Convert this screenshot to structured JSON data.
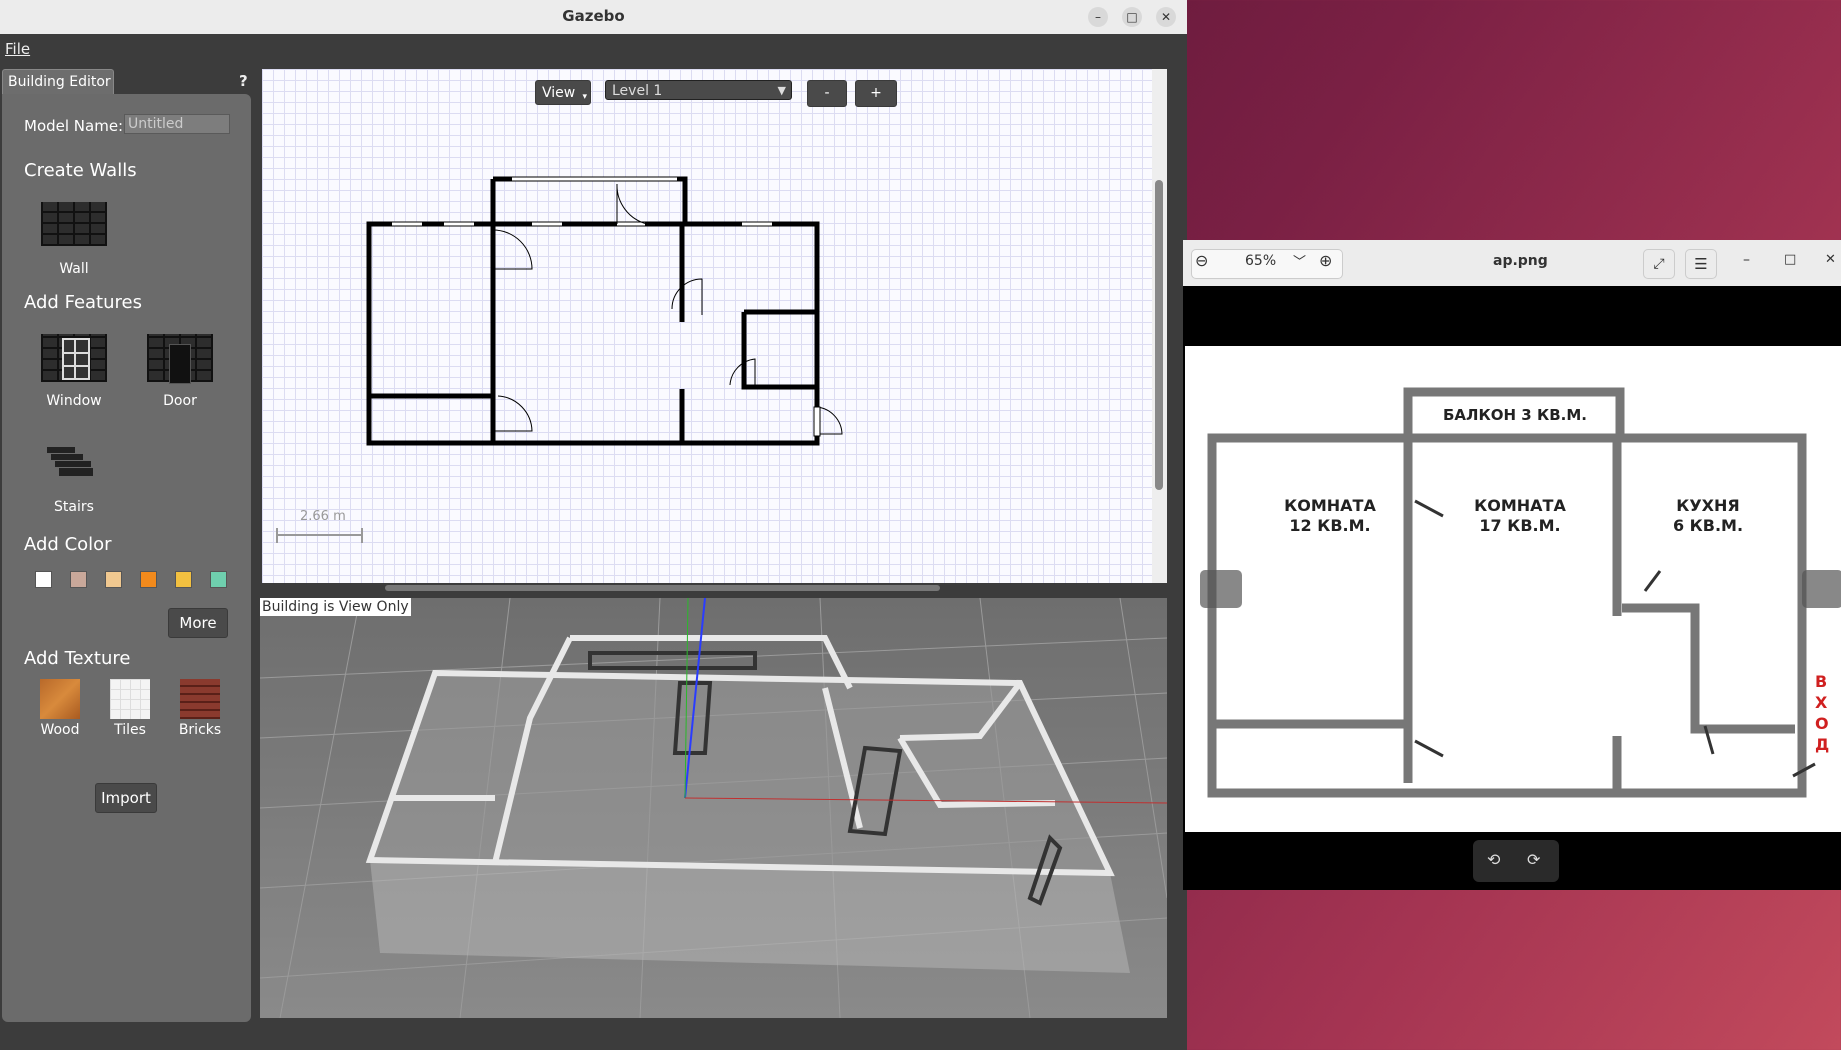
{
  "window": {
    "title": "Gazebo",
    "minimize": "–",
    "maximize": "□",
    "close": "✕"
  },
  "menu": {
    "file": "File"
  },
  "panel": {
    "tab": "Building Editor",
    "help": "?",
    "model_name_label": "Model Name:",
    "model_name_value": "Untitled",
    "create_walls": "Create Walls",
    "wall": "Wall",
    "add_features": "Add Features",
    "window": "Window",
    "door": "Door",
    "stairs": "Stairs",
    "add_color": "Add Color",
    "colors": [
      "#ffffff",
      "#c9a89a",
      "#f0c890",
      "#f28a1c",
      "#f2c040",
      "#6fcfae"
    ],
    "more": "More",
    "add_texture": "Add Texture",
    "wood": "Wood",
    "tiles": "Tiles",
    "bricks": "Bricks",
    "import": "Import"
  },
  "editor": {
    "view": "View",
    "level": "Level 1",
    "minus": "-",
    "plus": "+",
    "scale": "2.66 m",
    "view_only": "Building is View Only"
  },
  "viewer": {
    "zoom": "65%",
    "title": "ap.png",
    "rooms": [
      {
        "name": "БАЛКОН 3 КВ.М."
      },
      {
        "name": "КОМНАТА",
        "area": "12 КВ.М."
      },
      {
        "name": "КОМНАТА",
        "area": "17 КВ.М."
      },
      {
        "name": "КУХНЯ",
        "area": "6 КВ.М."
      }
    ],
    "entrance": [
      "В",
      "Х",
      "О",
      "Д"
    ]
  }
}
